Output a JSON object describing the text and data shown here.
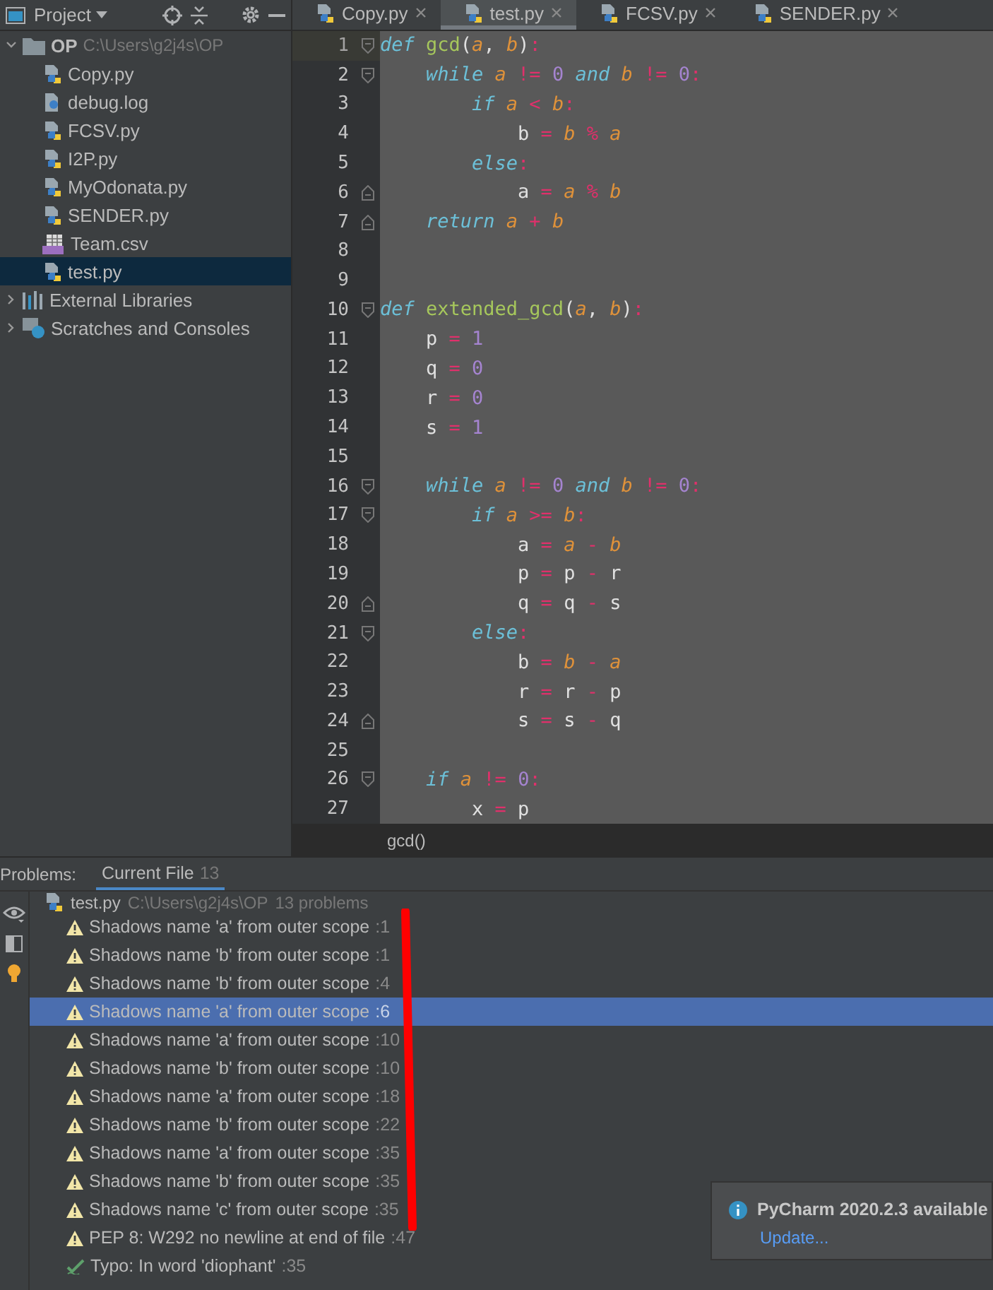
{
  "project_panel": {
    "title": "Project",
    "tree": [
      {
        "label": "OP",
        "path": "C:\\Users\\g2j4s\\OP",
        "kind": "folder",
        "expanded": true,
        "selected": false,
        "children": [
          {
            "label": "Copy.py",
            "kind": "py",
            "selected": false
          },
          {
            "label": "debug.log",
            "kind": "log",
            "selected": false
          },
          {
            "label": "FCSV.py",
            "kind": "py",
            "selected": false
          },
          {
            "label": "I2P.py",
            "kind": "py",
            "selected": false
          },
          {
            "label": "MyOdonata.py",
            "kind": "py",
            "selected": false
          },
          {
            "label": "SENDER.py",
            "kind": "py",
            "selected": false
          },
          {
            "label": "Team.csv",
            "kind": "csv",
            "selected": false
          },
          {
            "label": "test.py",
            "kind": "py",
            "selected": true
          }
        ]
      },
      {
        "label": "External Libraries",
        "kind": "libraries",
        "expanded": false,
        "selected": false
      },
      {
        "label": "Scratches and Consoles",
        "kind": "scratches",
        "expanded": false,
        "selected": false
      }
    ]
  },
  "editor_tabs": [
    {
      "label": "Copy.py",
      "selected": false
    },
    {
      "label": "test.py",
      "selected": true
    },
    {
      "label": "FCSV.py",
      "selected": false
    },
    {
      "label": "SENDER.py",
      "selected": false
    }
  ],
  "code_lines": [
    {
      "number": "1",
      "current": true,
      "fold_start": true,
      "tokens": [
        {
          "kind": "kw",
          "text": "def "
        },
        {
          "kind": "fn",
          "text": "gcd"
        },
        {
          "kind": "p",
          "text": "("
        },
        {
          "kind": "pa",
          "text": "a"
        },
        {
          "kind": "p",
          "text": ", "
        },
        {
          "kind": "pa",
          "text": "b"
        },
        {
          "kind": "p",
          "text": ")"
        },
        {
          "kind": "op",
          "text": ":"
        }
      ]
    },
    {
      "number": "2",
      "current": false,
      "fold_start": true,
      "tokens": [
        {
          "kind": "kw",
          "text": "    while "
        },
        {
          "kind": "pa",
          "text": "a "
        },
        {
          "kind": "op",
          "text": "!= "
        },
        {
          "kind": "num",
          "text": "0 "
        },
        {
          "kind": "kw",
          "text": "and "
        },
        {
          "kind": "pa",
          "text": "b "
        },
        {
          "kind": "op",
          "text": "!= "
        },
        {
          "kind": "num",
          "text": "0"
        },
        {
          "kind": "op",
          "text": ":"
        }
      ]
    },
    {
      "number": "3",
      "current": false,
      "tokens": [
        {
          "kind": "kw",
          "text": "        if "
        },
        {
          "kind": "pa",
          "text": "a "
        },
        {
          "kind": "op",
          "text": "< "
        },
        {
          "kind": "pa",
          "text": "b"
        },
        {
          "kind": "op",
          "text": ":"
        }
      ]
    },
    {
      "number": "4",
      "current": false,
      "tokens": [
        {
          "kind": "p",
          "text": "            b "
        },
        {
          "kind": "op",
          "text": "= "
        },
        {
          "kind": "pa",
          "text": "b "
        },
        {
          "kind": "op",
          "text": "% "
        },
        {
          "kind": "pa",
          "text": "a"
        }
      ]
    },
    {
      "number": "5",
      "current": false,
      "tokens": [
        {
          "kind": "kw",
          "text": "        else"
        },
        {
          "kind": "op",
          "text": ":"
        }
      ]
    },
    {
      "number": "6",
      "current": false,
      "fold_end": true,
      "tokens": [
        {
          "kind": "p",
          "text": "            a "
        },
        {
          "kind": "op",
          "text": "= "
        },
        {
          "kind": "pa",
          "text": "a "
        },
        {
          "kind": "op",
          "text": "% "
        },
        {
          "kind": "pa",
          "text": "b"
        }
      ]
    },
    {
      "number": "7",
      "current": false,
      "fold_end": true,
      "tokens": [
        {
          "kind": "kw",
          "text": "    return "
        },
        {
          "kind": "pa",
          "text": "a "
        },
        {
          "kind": "op",
          "text": "+ "
        },
        {
          "kind": "pa",
          "text": "b"
        }
      ]
    },
    {
      "number": "8",
      "current": false
    },
    {
      "number": "9",
      "current": false
    },
    {
      "number": "10",
      "current": false,
      "fold_start": true,
      "tokens": [
        {
          "kind": "kw",
          "text": "def "
        },
        {
          "kind": "fn",
          "text": "extended_gcd"
        },
        {
          "kind": "p",
          "text": "("
        },
        {
          "kind": "pa",
          "text": "a"
        },
        {
          "kind": "p",
          "text": ", "
        },
        {
          "kind": "pa",
          "text": "b"
        },
        {
          "kind": "p",
          "text": ")"
        },
        {
          "kind": "op",
          "text": ":"
        }
      ]
    },
    {
      "number": "11",
      "current": false,
      "tokens": [
        {
          "kind": "p",
          "text": "    p "
        },
        {
          "kind": "op",
          "text": "= "
        },
        {
          "kind": "num",
          "text": "1"
        }
      ]
    },
    {
      "number": "12",
      "current": false,
      "tokens": [
        {
          "kind": "p",
          "text": "    q "
        },
        {
          "kind": "op",
          "text": "= "
        },
        {
          "kind": "num",
          "text": "0"
        }
      ]
    },
    {
      "number": "13",
      "current": false,
      "tokens": [
        {
          "kind": "p",
          "text": "    r "
        },
        {
          "kind": "op",
          "text": "= "
        },
        {
          "kind": "num",
          "text": "0"
        }
      ]
    },
    {
      "number": "14",
      "current": false,
      "tokens": [
        {
          "kind": "p",
          "text": "    s "
        },
        {
          "kind": "op",
          "text": "= "
        },
        {
          "kind": "num",
          "text": "1"
        }
      ]
    },
    {
      "number": "15",
      "current": false
    },
    {
      "number": "16",
      "current": false,
      "fold_start": true,
      "tokens": [
        {
          "kind": "kw",
          "text": "    while "
        },
        {
          "kind": "pa",
          "text": "a "
        },
        {
          "kind": "op",
          "text": "!= "
        },
        {
          "kind": "num",
          "text": "0 "
        },
        {
          "kind": "kw",
          "text": "and "
        },
        {
          "kind": "pa",
          "text": "b "
        },
        {
          "kind": "op",
          "text": "!= "
        },
        {
          "kind": "num",
          "text": "0"
        },
        {
          "kind": "op",
          "text": ":"
        }
      ]
    },
    {
      "number": "17",
      "current": false,
      "fold_start": true,
      "tokens": [
        {
          "kind": "kw",
          "text": "        if "
        },
        {
          "kind": "pa",
          "text": "a "
        },
        {
          "kind": "op",
          "text": ">= "
        },
        {
          "kind": "pa",
          "text": "b"
        },
        {
          "kind": "op",
          "text": ":"
        }
      ]
    },
    {
      "number": "18",
      "current": false,
      "tokens": [
        {
          "kind": "p",
          "text": "            a "
        },
        {
          "kind": "op",
          "text": "= "
        },
        {
          "kind": "pa",
          "text": "a "
        },
        {
          "kind": "op",
          "text": "- "
        },
        {
          "kind": "pa",
          "text": "b"
        }
      ]
    },
    {
      "number": "19",
      "current": false,
      "tokens": [
        {
          "kind": "p",
          "text": "            p "
        },
        {
          "kind": "op",
          "text": "= "
        },
        {
          "kind": "p",
          "text": "p "
        },
        {
          "kind": "op",
          "text": "- "
        },
        {
          "kind": "p",
          "text": "r"
        }
      ]
    },
    {
      "number": "20",
      "current": false,
      "fold_end": true,
      "tokens": [
        {
          "kind": "p",
          "text": "            q "
        },
        {
          "kind": "op",
          "text": "= "
        },
        {
          "kind": "p",
          "text": "q "
        },
        {
          "kind": "op",
          "text": "- "
        },
        {
          "kind": "p",
          "text": "s"
        }
      ]
    },
    {
      "number": "21",
      "current": false,
      "fold_start": true,
      "tokens": [
        {
          "kind": "kw",
          "text": "        else"
        },
        {
          "kind": "op",
          "text": ":"
        }
      ]
    },
    {
      "number": "22",
      "current": false,
      "tokens": [
        {
          "kind": "p",
          "text": "            b "
        },
        {
          "kind": "op",
          "text": "= "
        },
        {
          "kind": "pa",
          "text": "b "
        },
        {
          "kind": "op",
          "text": "- "
        },
        {
          "kind": "pa",
          "text": "a"
        }
      ]
    },
    {
      "number": "23",
      "current": false,
      "tokens": [
        {
          "kind": "p",
          "text": "            r "
        },
        {
          "kind": "op",
          "text": "= "
        },
        {
          "kind": "p",
          "text": "r "
        },
        {
          "kind": "op",
          "text": "- "
        },
        {
          "kind": "p",
          "text": "p"
        }
      ]
    },
    {
      "number": "24",
      "current": false,
      "fold_end": true,
      "tokens": [
        {
          "kind": "p",
          "text": "            s "
        },
        {
          "kind": "op",
          "text": "= "
        },
        {
          "kind": "p",
          "text": "s "
        },
        {
          "kind": "op",
          "text": "- "
        },
        {
          "kind": "p",
          "text": "q"
        }
      ]
    },
    {
      "number": "25",
      "current": false
    },
    {
      "number": "26",
      "current": false,
      "fold_start": true,
      "tokens": [
        {
          "kind": "kw",
          "text": "    if "
        },
        {
          "kind": "pa",
          "text": "a "
        },
        {
          "kind": "op",
          "text": "!= "
        },
        {
          "kind": "num",
          "text": "0"
        },
        {
          "kind": "op",
          "text": ":"
        }
      ]
    },
    {
      "number": "27",
      "current": false,
      "tokens": [
        {
          "kind": "p",
          "text": "        x "
        },
        {
          "kind": "op",
          "text": "= "
        },
        {
          "kind": "p",
          "text": "p"
        }
      ]
    }
  ],
  "breadcrumb": "gcd()",
  "problems": {
    "title": "Problems:",
    "tabs": [
      {
        "label": "Current File",
        "count": "13",
        "selected": true
      }
    ],
    "file": {
      "name": "test.py",
      "path": "C:\\Users\\g2j4s\\OP",
      "count": "13 problems"
    },
    "items": [
      {
        "kind": "warning",
        "text": "Shadows name 'a' from outer scope",
        "line": ":1",
        "selected": false
      },
      {
        "kind": "warning",
        "text": "Shadows name 'b' from outer scope",
        "line": ":1",
        "selected": false
      },
      {
        "kind": "warning",
        "text": "Shadows name 'b' from outer scope",
        "line": ":4",
        "selected": false
      },
      {
        "kind": "warning",
        "text": "Shadows name 'a' from outer scope",
        "line": ":6",
        "selected": true
      },
      {
        "kind": "warning",
        "text": "Shadows name 'a' from outer scope",
        "line": ":10",
        "selected": false
      },
      {
        "kind": "warning",
        "text": "Shadows name 'b' from outer scope",
        "line": ":10",
        "selected": false
      },
      {
        "kind": "warning",
        "text": "Shadows name 'a' from outer scope",
        "line": ":18",
        "selected": false
      },
      {
        "kind": "warning",
        "text": "Shadows name 'b' from outer scope",
        "line": ":22",
        "selected": false
      },
      {
        "kind": "warning",
        "text": "Shadows name 'a' from outer scope",
        "line": ":35",
        "selected": false
      },
      {
        "kind": "warning",
        "text": "Shadows name 'b' from outer scope",
        "line": ":35",
        "selected": false
      },
      {
        "kind": "warning",
        "text": "Shadows name 'c' from outer scope",
        "line": ":35",
        "selected": false
      },
      {
        "kind": "warning",
        "text": "PEP 8: W292 no newline at end of file",
        "line": ":47",
        "selected": false
      },
      {
        "kind": "typo",
        "text": "Typo: In word 'diophant'",
        "line": ":35",
        "selected": false
      }
    ]
  },
  "notification": {
    "title": "PyCharm 2020.2.3 available",
    "link": "Update..."
  }
}
